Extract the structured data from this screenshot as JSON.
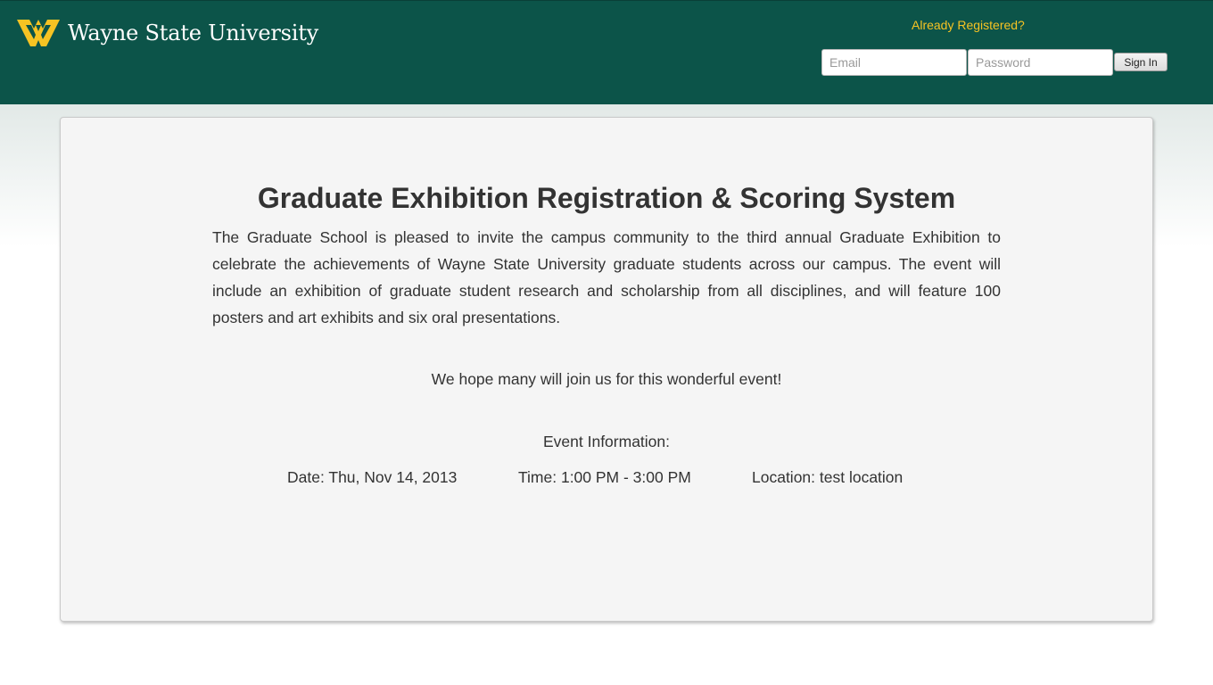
{
  "header": {
    "university_name": "Wayne State University",
    "logo_icon": "wsu-w-logo",
    "brand_color": "#0c5449",
    "accent_color": "#f6c323",
    "login": {
      "prompt": "Already Registered?",
      "email_placeholder": "Email",
      "email_value": "",
      "password_placeholder": "Password",
      "password_value": "",
      "signin_label": "Sign In"
    }
  },
  "main": {
    "title": "Graduate Exhibition Registration & Scoring System",
    "intro": "The Graduate School is pleased to invite the campus community to the third annual Graduate Exhibition to celebrate the achievements of Wayne State University graduate students across our campus. The event will include an exhibition of graduate student research and scholarship from all disciplines, and will feature 100 posters and art exhibits and six oral presentations.",
    "hope": "We hope many will join us for this wonderful event!",
    "event": {
      "heading": "Event Information:",
      "date": "Date: Thu, Nov 14, 2013",
      "time": "Time: 1:00 PM - 3:00 PM",
      "location": "Location: test location"
    }
  }
}
